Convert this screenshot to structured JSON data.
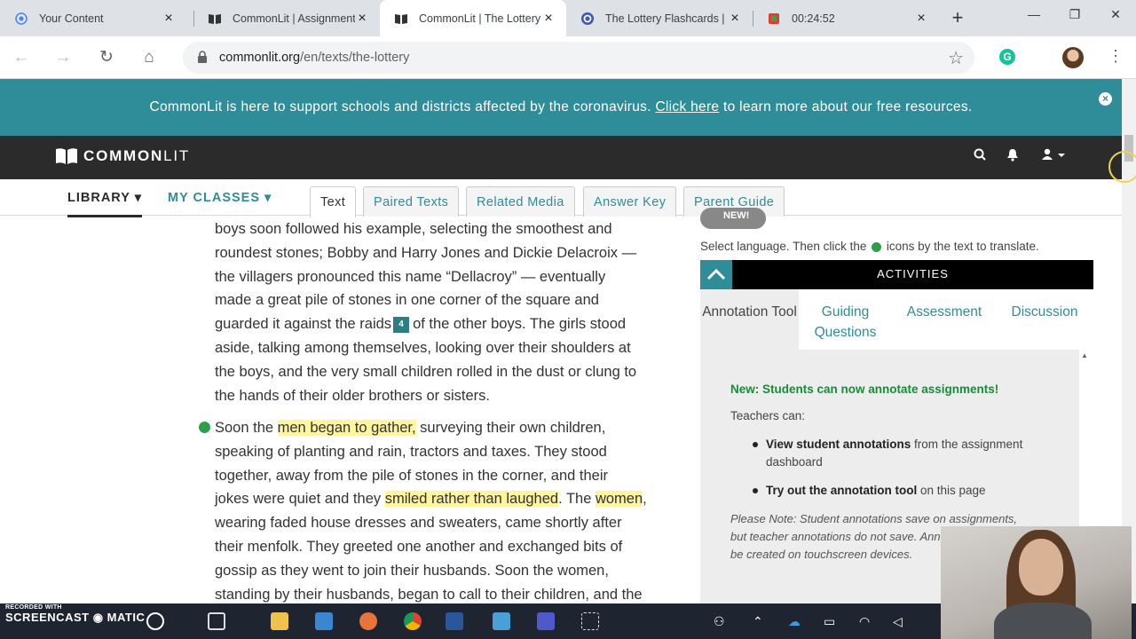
{
  "browser": {
    "tabs": [
      {
        "title": "Your Content",
        "icon": "screencast-icon"
      },
      {
        "title": "CommonLit | Assignment",
        "icon": "book-icon"
      },
      {
        "title": "CommonLit | The Lottery",
        "icon": "book-icon",
        "active": true
      },
      {
        "title": "The Lottery Flashcards | Q",
        "icon": "quizlet-icon"
      },
      {
        "title": "00:24:52",
        "icon": "timer-icon"
      }
    ],
    "url_host": "commonlit.org",
    "url_path": "/en/texts/the-lottery"
  },
  "banner": {
    "text_before": "CommonLit is here to support schools and districts affected by the coronavirus.",
    "link": "Click here",
    "text_after": "to learn more about our free resources."
  },
  "header": {
    "logo_bold": "COMMON",
    "logo_light": "LIT"
  },
  "subnav": {
    "library": "LIBRARY",
    "my_classes": "MY CLASSES",
    "tabs": [
      "Text",
      "Paired Texts",
      "Related Media",
      "Answer Key",
      "Parent Guide"
    ]
  },
  "text": {
    "p1_lines": [
      "boys soon followed his example, selecting the smoothest and",
      "roundest stones; Bobby and Harry Jones and Dickie Delacroix —",
      "the villagers pronounced this name “Dellacroy” — eventually",
      "made a great pile of stones in one corner of the square and"
    ],
    "p1_l5_before": "guarded it against the raids",
    "footnote": "4",
    "p1_l5_after": "of the other boys. The girls stood",
    "p1_lines_b": [
      "aside, talking among themselves, looking over their shoulders at",
      "the boys, and the very small children rolled in the dust or clung to",
      "the hands of their older brothers or sisters."
    ],
    "p2_l1_before": "Soon the ",
    "hl1": "men began to gather,",
    "p2_l1_after": " surveying their own children,",
    "p2_l2": "speaking of planting and rain, tractors and taxes. They stood",
    "p2_l3": "together, away from the pile of stones in the corner, and their",
    "p2_l4_before": "jokes were quiet and they ",
    "hl2": "smiled rather than laughed",
    "p2_l4_mid": ". The ",
    "hl3": "women",
    "p2_l4_after": ",",
    "p2_lines_b": [
      "wearing faded house dresses and sweaters, came shortly after",
      "their menfolk. They greeted one another and exchanged bits of",
      "gossip as they went to join their husbands. Soon the women,",
      "standing by their husbands, began to call to their children, and the"
    ]
  },
  "panel": {
    "new_badge": "NEW!",
    "lang_before": "Select language. Then click the",
    "lang_after": "icons by the text to translate.",
    "activities_title": "ACTIVITIES",
    "tabs": [
      "Annotation Tool",
      "Guiding Questions",
      "Assessment",
      "Discussion"
    ],
    "new_students": "New: Students can now annotate assignments!",
    "teachers_can": "Teachers can:",
    "bullet1_bold": "View student annotations",
    "bullet1_rest": " from the assignment dashboard",
    "bullet2_bold": "Try out the annotation tool",
    "bullet2_rest": " on this page",
    "note": "Please Note: Student annotations save on assignments, but teacher annotations do not save. Annotations cannot be created on touchscreen devices."
  },
  "taskbar": {
    "recorded_with": "RECORDED WITH",
    "screencast": "SCREENCAST",
    "matic": "MATIC"
  }
}
